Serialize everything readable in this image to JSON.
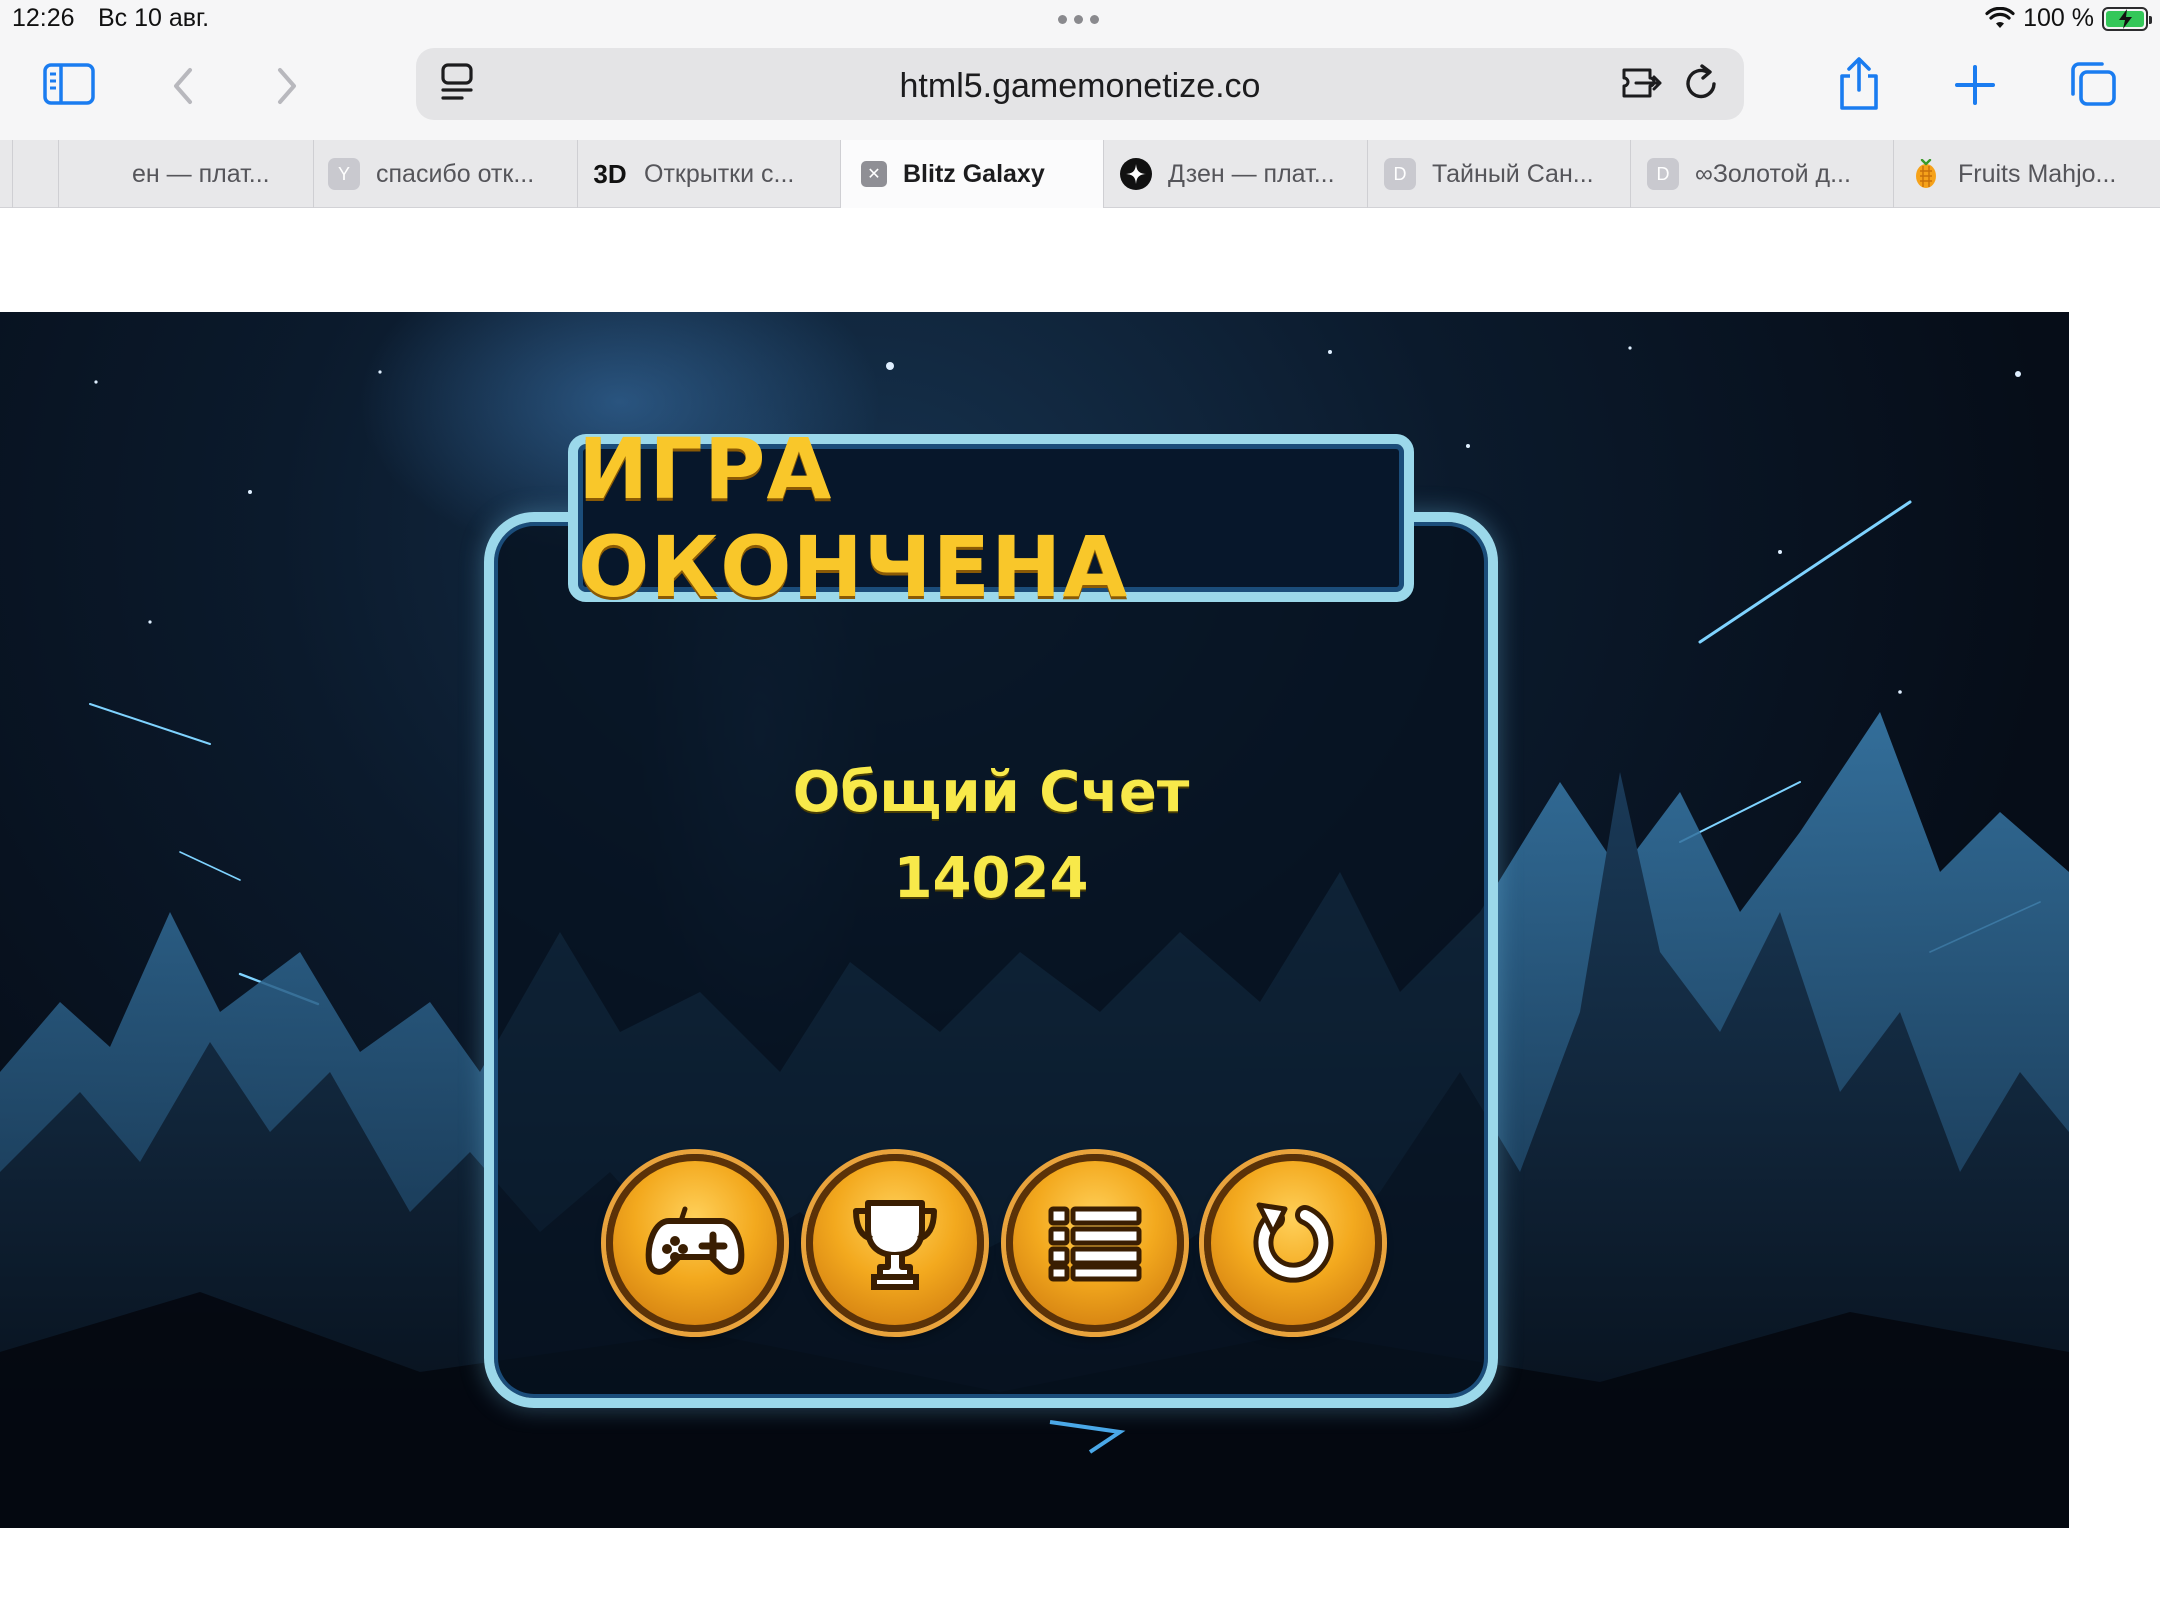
{
  "status_bar": {
    "time": "12:26",
    "date": "Вс 10 авг.",
    "battery_pct": "100 %"
  },
  "browser": {
    "url": "html5.gamemonetize.co",
    "tabs": [
      {
        "label": "",
        "favicon": "none",
        "active": false
      },
      {
        "label": "ен — плат...",
        "favicon": "none",
        "active": false
      },
      {
        "label": "спасибо отк...",
        "favicon": "Y",
        "active": false
      },
      {
        "label": "Открытки с...",
        "favicon": "3D",
        "active": false
      },
      {
        "label": "Blitz Galaxy",
        "favicon": "close-icon",
        "active": true
      },
      {
        "label": "Дзен — плат...",
        "favicon": "zen-icon",
        "active": false
      },
      {
        "label": "Тайный Сан...",
        "favicon": "D",
        "active": false
      },
      {
        "label": "∞Золотой д...",
        "favicon": "D",
        "active": false
      },
      {
        "label": "Fruits Mahjo...",
        "favicon": "fruit-icon",
        "active": false
      }
    ]
  },
  "game": {
    "title": "ИГРА ОКОНЧЕНА",
    "score_label": "Общий Счет",
    "score_value": "14024",
    "buttons": [
      "gamepad-icon",
      "trophy-icon",
      "list-icon",
      "restart-icon"
    ],
    "colors": {
      "title": "#f9c72a",
      "score": "#f8e94a",
      "frame": "#9bd8ea",
      "button": "#f3a91e"
    }
  }
}
